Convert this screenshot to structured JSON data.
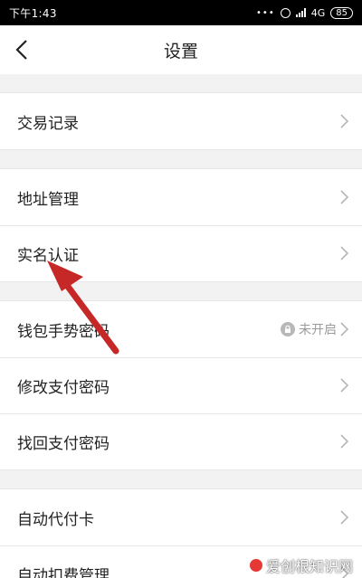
{
  "status_bar": {
    "time": "下午1:43",
    "dots": "•••",
    "network": "4G",
    "battery": "85"
  },
  "header": {
    "title": "设置"
  },
  "groups": [
    {
      "items": [
        {
          "label": "交易记录"
        }
      ]
    },
    {
      "items": [
        {
          "label": "地址管理"
        },
        {
          "label": "实名认证"
        }
      ]
    },
    {
      "items": [
        {
          "label": "钱包手势密码",
          "status": "未开启"
        },
        {
          "label": "修改支付密码"
        },
        {
          "label": "找回支付密码"
        }
      ]
    },
    {
      "items": [
        {
          "label": "自动代付卡"
        },
        {
          "label": "自动扣费管理"
        }
      ]
    }
  ],
  "annotation": {
    "color": "#c62828"
  },
  "watermark": {
    "text": "爱创根知识网"
  },
  "icons": {
    "back": "chevron-left-icon",
    "row_arrow": "chevron-right-icon",
    "lock": "lock-icon",
    "alarm": "alarm-icon",
    "signal": "signal-icon"
  }
}
